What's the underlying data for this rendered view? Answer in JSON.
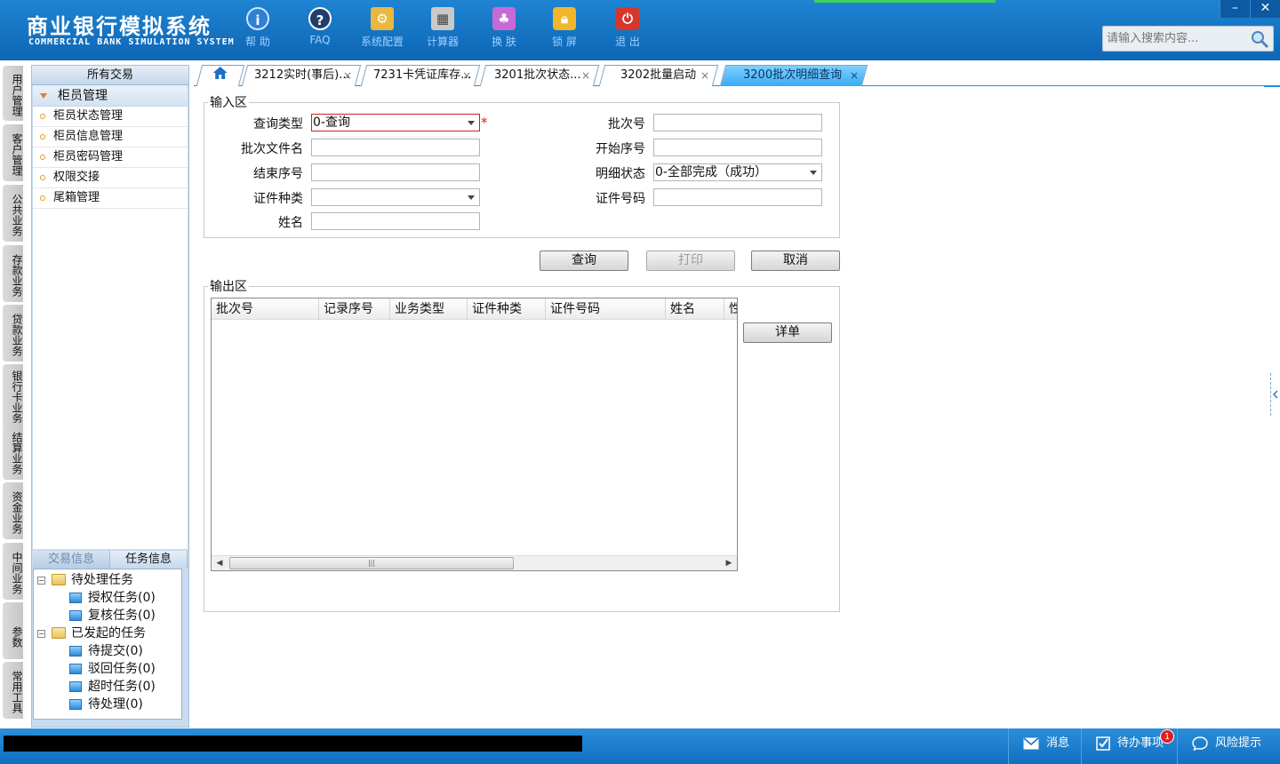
{
  "header": {
    "title": "商业银行模拟系统",
    "subtitle": "COMMERCIAL BANK SIMULATION SYSTEM",
    "tools": [
      {
        "label": "帮 助",
        "icon": "info-icon"
      },
      {
        "label": "FAQ",
        "icon": "question-icon"
      },
      {
        "label": "系统配置",
        "icon": "config-icon"
      },
      {
        "label": "计算器",
        "icon": "calculator-icon"
      },
      {
        "label": "换 肤",
        "icon": "shirt-icon"
      },
      {
        "label": "锁 屏",
        "icon": "lock-icon"
      },
      {
        "label": "退 出",
        "icon": "power-icon"
      }
    ],
    "window": {
      "minimize": "–",
      "close": "✕"
    },
    "search_placeholder": "请输入搜索内容..."
  },
  "vnav": [
    "用户管理",
    "客户管理",
    "公共业务",
    "存款业务",
    "贷款业务",
    "银行卡业务",
    "结算业务",
    "资金业务",
    "中间业务",
    "参数",
    "常用工具"
  ],
  "sidebar": {
    "header": "所有交易",
    "group": "柜员管理",
    "items": [
      "柜员状态管理",
      "柜员信息管理",
      "柜员密码管理",
      "权限交接",
      "尾箱管理"
    ],
    "info_tabs": [
      "交易信息",
      "任务信息"
    ],
    "tree": {
      "pending": "待处理任务",
      "pending_children": [
        "授权任务(0)",
        "复核任务(0)"
      ],
      "initiated": "已发起的任务",
      "initiated_children": [
        "待提交(0)",
        "驳回任务(0)",
        "超时任务(0)",
        "待处理(0)"
      ]
    }
  },
  "tabs": [
    {
      "label": "3212实时(事后)..."
    },
    {
      "label": "7231卡凭证库存..."
    },
    {
      "label": "3201批次状态..."
    },
    {
      "label": "3202批量启动"
    },
    {
      "label": "3200批次明细查询"
    }
  ],
  "form": {
    "input_legend": "输入区",
    "query_type_label": "查询类型",
    "query_type_value": "0-查询",
    "required_mark": "*",
    "batch_no_label": "批次号",
    "batch_file_label": "批次文件名",
    "start_seq_label": "开始序号",
    "end_seq_label": "结束序号",
    "detail_status_label": "明细状态",
    "detail_status_value": "0-全部完成（成功）",
    "id_type_label": "证件种类",
    "id_no_label": "证件号码",
    "name_label": "姓名",
    "query_button": "查询",
    "print_button": "打印",
    "cancel_button": "取消",
    "output_legend": "输出区",
    "detail_button": "详单",
    "columns": [
      "批次号",
      "记录序号",
      "业务类型",
      "证件种类",
      "证件号码",
      "姓名",
      "性"
    ]
  },
  "statusbar": {
    "message": "消息",
    "todo": "待办事项",
    "todo_count": "1",
    "risk": "风险提示"
  },
  "colors": {
    "header_blue": "#1478c8",
    "active_tab": "#39aaf2",
    "required": "#d02020"
  }
}
